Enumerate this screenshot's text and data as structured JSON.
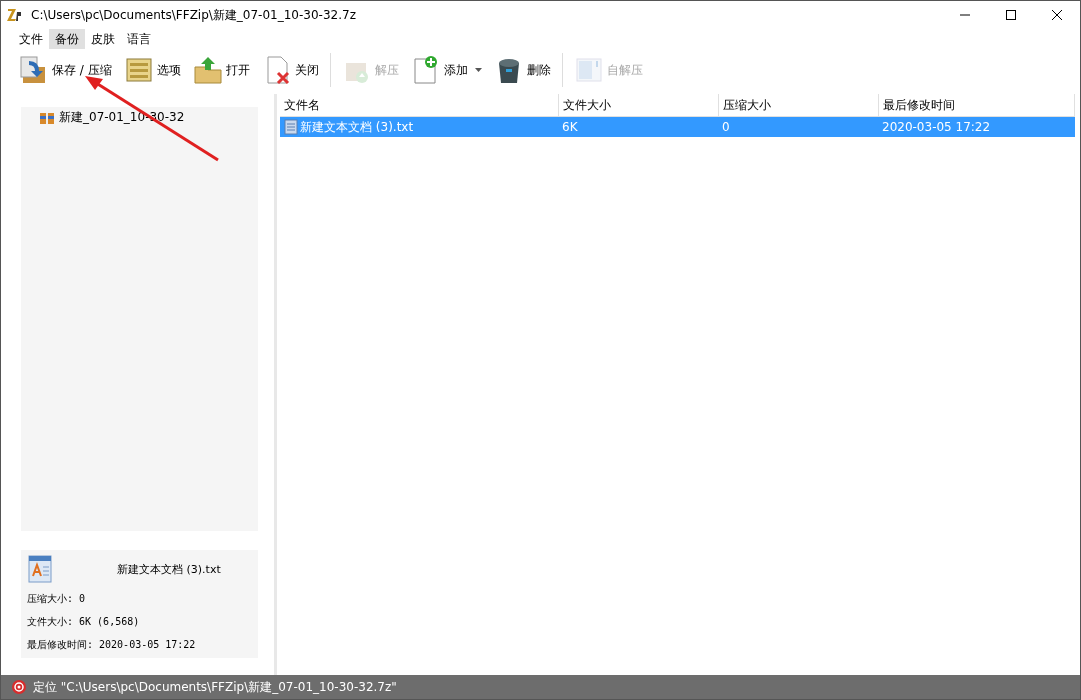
{
  "window": {
    "title": "C:\\Users\\pc\\Documents\\FFZip\\新建_07-01_10-30-32.7z"
  },
  "menu": [
    {
      "label": "文件",
      "selected": false
    },
    {
      "label": "备份",
      "selected": true
    },
    {
      "label": "皮肤",
      "selected": false
    },
    {
      "label": "语言",
      "selected": false
    }
  ],
  "toolbar": [
    {
      "label": "保存 / 压缩",
      "disabled": false
    },
    {
      "label": "选项",
      "disabled": false
    },
    {
      "label": "打开",
      "disabled": false
    },
    {
      "label": "关闭",
      "disabled": false
    },
    {
      "label": "解压",
      "disabled": true
    },
    {
      "label": "添加",
      "disabled": false,
      "dropdown": true
    },
    {
      "label": "删除",
      "disabled": false
    },
    {
      "label": "自解压",
      "disabled": true
    }
  ],
  "tree": {
    "items": [
      {
        "label": "新建_07-01_10-30-32"
      }
    ]
  },
  "file_info": {
    "name": "新建文本文档 (3).txt",
    "lines": [
      "压缩大小: 0",
      "文件大小: 6K (6,568)",
      "最后修改时间: 2020-03-05 17:22"
    ]
  },
  "table": {
    "columns": [
      "文件名",
      "文件大小",
      "压缩大小",
      "最后修改时间"
    ],
    "rows": [
      {
        "cells": [
          "新建文本文档 (3).txt",
          "6K",
          "0",
          "2020-03-05 17:22"
        ],
        "selected": true
      }
    ]
  },
  "status_bar": {
    "text": "定位 \"C:\\Users\\pc\\Documents\\FFZip\\新建_07-01_10-30-32.7z\""
  }
}
